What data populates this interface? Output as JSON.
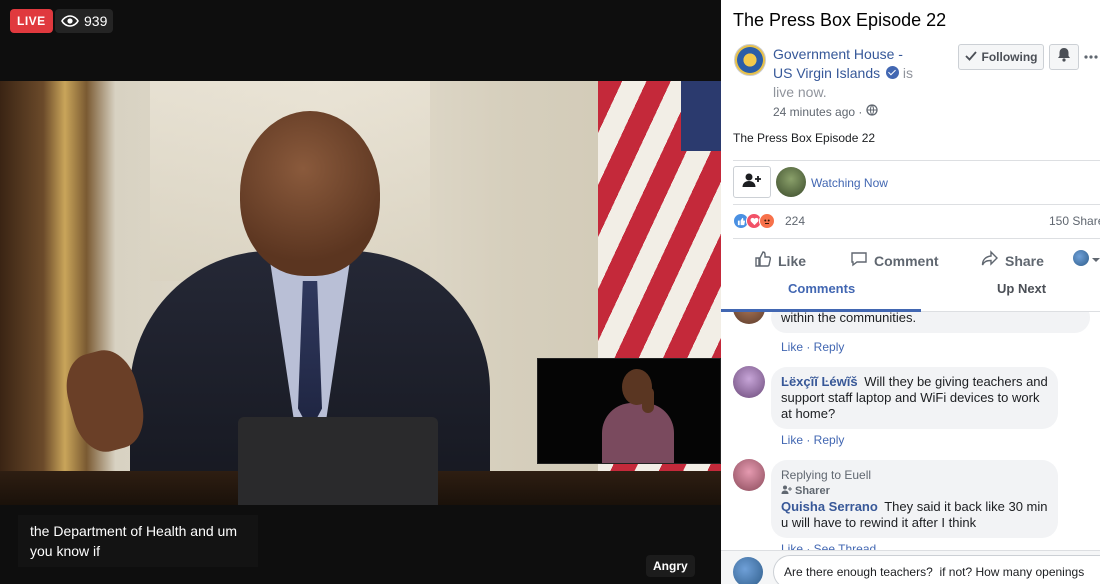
{
  "video": {
    "live_label": "LIVE",
    "viewer_count": "939",
    "caption_line1": "the Department of Health and um",
    "caption_line2": "you know if",
    "reaction_label": "Angry"
  },
  "panel": {
    "title": "The Press Box Episode 22",
    "page_name_line1": "Government House -",
    "page_name_line2": "US Virgin Islands",
    "status_is": "is",
    "status_live": "live now.",
    "timestamp": "24 minutes ago ·",
    "follow_label": "Following",
    "description": "The Press Box Episode 22",
    "watching_now": "Watching Now",
    "reaction_count": "224",
    "share_count": "150 Shares",
    "actions": {
      "like": "Like",
      "comment": "Comment",
      "share": "Share"
    },
    "tabs": {
      "comments": "Comments",
      "up_next": "Up Next"
    }
  },
  "comments": [
    {
      "author": "",
      "text": "within the communities.",
      "links": "Like · Reply"
    },
    {
      "author": "Ŀëxçĩĩ Ŀéwĩš",
      "text": "Will they be giving teachers and support staff laptop and WiFi devices to work at home?",
      "links": "Like · Reply"
    },
    {
      "reply_note": "Replying to Euell",
      "sharer_tag": "Sharer",
      "author": "Quisha Serrano",
      "text": "They said it back like 30 min u will have to rewind it after I think",
      "links": "Like · See Thread"
    }
  ],
  "composer": {
    "value": "Are there enough teachers?  if not? How many openings"
  },
  "colors": {
    "live_red": "#e0393e",
    "link_blue": "#4267b2",
    "author_blue": "#385898"
  },
  "icons": [
    "eye-icon",
    "verified-badge-icon",
    "check-icon",
    "bell-icon",
    "more-icon",
    "globe-icon",
    "add-friend-icon",
    "thumbs-up-icon",
    "comment-icon",
    "share-icon",
    "chevron-down-icon"
  ]
}
